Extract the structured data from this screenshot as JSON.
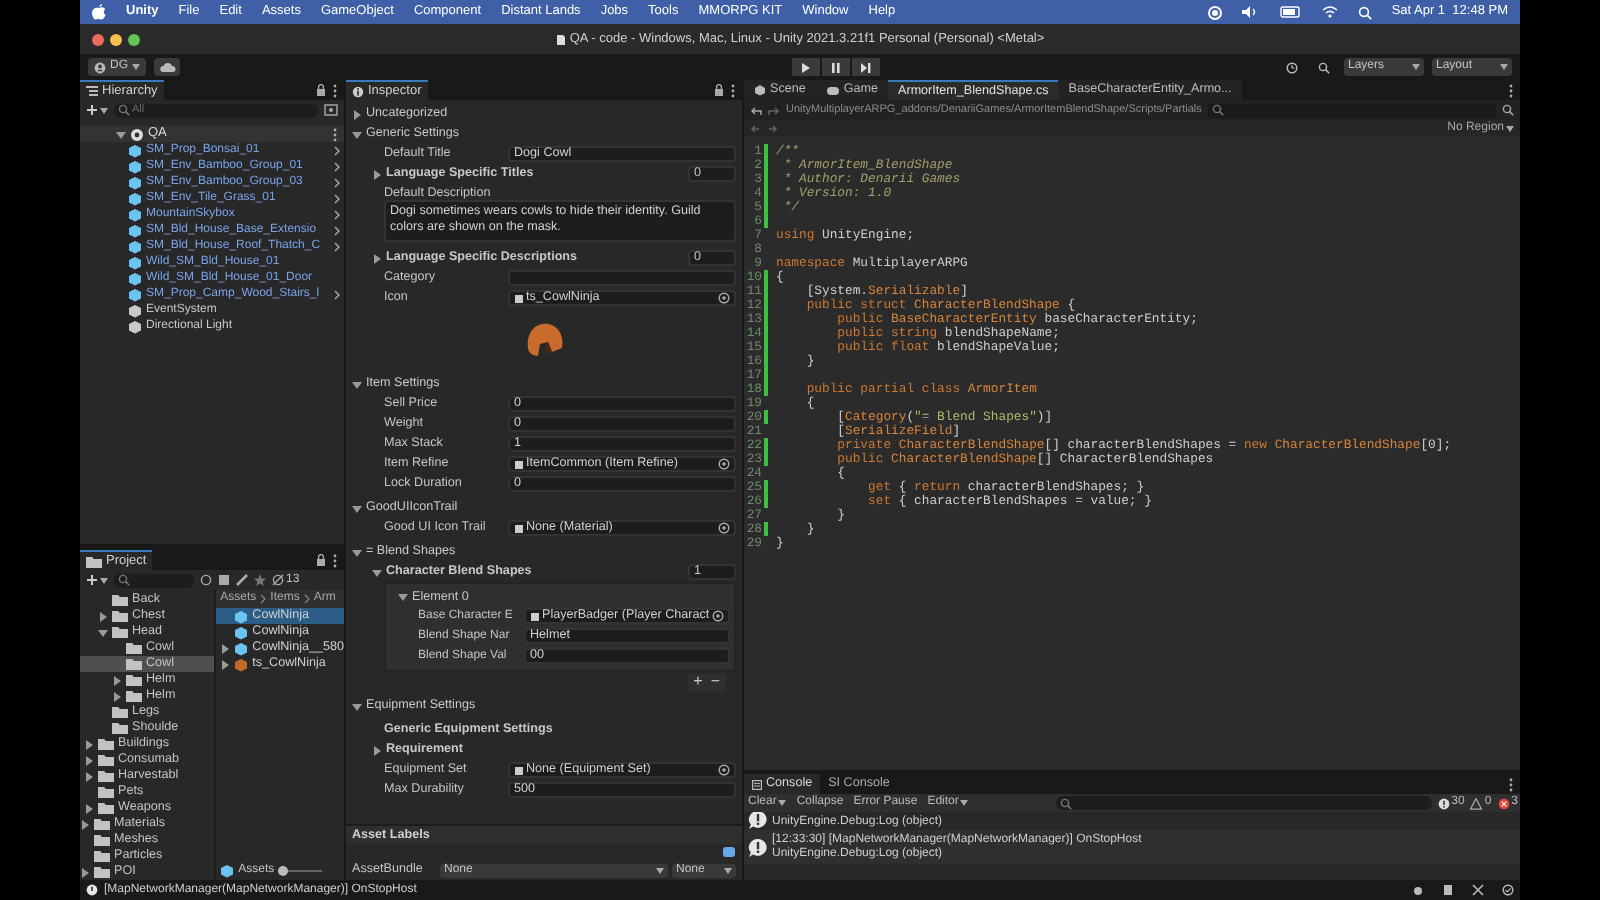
{
  "menu_bar": {
    "items": [
      {
        "label": "Unity",
        "kind": "app"
      },
      {
        "label": "File",
        "kind": "menu"
      },
      {
        "label": "Edit",
        "kind": "menu"
      },
      {
        "label": "Assets",
        "kind": "menu"
      },
      {
        "label": "GameObject",
        "kind": "menu"
      },
      {
        "label": "Component",
        "kind": "menu"
      },
      {
        "label": "Distant Lands",
        "kind": "menu"
      },
      {
        "label": "Jobs",
        "kind": "menu"
      },
      {
        "label": "Tools",
        "kind": "menu"
      },
      {
        "label": "MMORPG KIT",
        "kind": "menu"
      },
      {
        "label": "Window",
        "kind": "menu"
      },
      {
        "label": "Help",
        "kind": "menu"
      }
    ],
    "clock": "Sat Apr 1  12:48 PM"
  },
  "window": {
    "title": "QA - code - Windows, Mac, Linux - Unity 2021.3.21f1 Personal (Personal) <Metal>"
  },
  "toolbar": {
    "account": "DG",
    "layers": "Layers",
    "layout": "Layout"
  },
  "hierarchy": {
    "title": "Hierarchy",
    "search": {
      "placeholder": "All"
    },
    "scene": "QA",
    "items": [
      {
        "label": "SM_Prop_Bonsai_01",
        "kind": "prefab",
        "has_children": true
      },
      {
        "label": "SM_Env_Bamboo_Group_01",
        "kind": "prefab",
        "has_children": true
      },
      {
        "label": "SM_Env_Bamboo_Group_03",
        "kind": "prefab",
        "has_children": true
      },
      {
        "label": "SM_Env_Tile_Grass_01",
        "kind": "prefab",
        "has_children": true
      },
      {
        "label": "MountainSkybox",
        "kind": "prefab",
        "has_children": true
      },
      {
        "label": "SM_Bld_House_Base_Extensio",
        "kind": "prefab",
        "has_children": true
      },
      {
        "label": "SM_Bld_House_Roof_Thatch_C",
        "kind": "prefab",
        "has_children": true
      },
      {
        "label": "Wild_SM_Bld_House_01",
        "kind": "prefab",
        "has_children": false
      },
      {
        "label": "Wild_SM_Bld_House_01_Door",
        "kind": "prefab",
        "has_children": false
      },
      {
        "label": "SM_Prop_Camp_Wood_Stairs_l",
        "kind": "prefab",
        "has_children": true
      },
      {
        "label": "EventSystem",
        "kind": "object",
        "has_children": false
      },
      {
        "label": "Directional Light",
        "kind": "object",
        "has_children": false
      }
    ]
  },
  "project": {
    "title": "Project",
    "hidden_count": "13",
    "folders": [
      {
        "children": [
          {
            "children": [
              {
                "label": "Back",
                "selected": false
              },
              {
                "label": "Chest",
                "expanded": false,
                "selected": false
              },
              {
                "label": "Head",
                "expanded": true,
                "selected": false,
                "children": [
                  {
                    "label": "Cowl",
                    "selected": false
                  },
                  {
                    "label": "Cowl",
                    "selected": true
                  },
                  {
                    "label": "Helm",
                    "expanded": false,
                    "selected": false
                  },
                  {
                    "label": "Helm",
                    "expanded": false,
                    "selected": false
                  }
                ]
              },
              {
                "label": "Legs",
                "selected": false
              },
              {
                "label": "Shoulde",
                "selected": false
              }
            ]
          },
          {
            "label": "Buildings",
            "expanded": false,
            "selected": false
          },
          {
            "label": "Consumab",
            "expanded": false,
            "selected": false
          },
          {
            "label": "Harvestabl",
            "expanded": false,
            "selected": false
          },
          {
            "label": "Pets",
            "selected": false
          },
          {
            "label": "Weapons",
            "expanded": false,
            "selected": false
          }
        ]
      },
      {
        "label": "Materials",
        "expanded": false,
        "selected": false
      },
      {
        "label": "Meshes",
        "selected": false
      },
      {
        "label": "Particles",
        "selected": false
      },
      {
        "label": "POI",
        "expanded": false,
        "selected": false
      }
    ],
    "breadcrumb": [
      "Assets",
      "Items",
      "Arm"
    ],
    "assets": [
      {
        "label": "CowlNinja",
        "selected": true
      },
      {
        "label": "CowlNinja",
        "selected": false
      },
      {
        "label": "CowlNinja__580",
        "selected": false,
        "expanded": false
      },
      {
        "label": "ts_CowlNinja",
        "selected": false,
        "expanded": false
      }
    ],
    "footer": "Assets",
    "zoom": {
      "level": 0
    }
  },
  "inspector": {
    "title": "Inspector",
    "items": [
      {
        "kind": "foldout",
        "label": "Uncategorized",
        "expanded": false
      },
      {
        "kind": "foldout",
        "label": "Generic Settings",
        "expanded": true
      },
      {
        "kind": "field",
        "label": "Default Title",
        "value": "Dogi Cowl"
      },
      {
        "kind": "list",
        "label": "Language Specific Titles",
        "count": "0",
        "expanded": false
      },
      {
        "kind": "textarea",
        "label": "Default Description",
        "value": "Dogi sometimes wears cowls to hide their identity. Guild colors are shown on the mask."
      },
      {
        "kind": "list",
        "label": "Language Specific Descriptions",
        "count": "0",
        "expanded": false
      },
      {
        "kind": "field",
        "label": "Category"
      },
      {
        "kind": "object",
        "label": "Icon",
        "value": "ts_CowlNinja"
      },
      {
        "kind": "preview"
      },
      {
        "kind": "foldout",
        "label": "Item Settings",
        "expanded": true
      },
      {
        "kind": "field",
        "label": "Sell Price",
        "value": "0"
      },
      {
        "kind": "field",
        "label": "Weight",
        "value": "0"
      },
      {
        "kind": "field",
        "label": "Max Stack",
        "value": "1"
      },
      {
        "kind": "object",
        "label": "Item Refine",
        "value": "ItemCommon (Item Refine)"
      },
      {
        "kind": "field",
        "label": "Lock Duration",
        "value": "0"
      },
      {
        "kind": "foldout",
        "label": "GoodUIIconTrail",
        "expanded": true
      },
      {
        "kind": "object",
        "label": "Good UI Icon Trail",
        "value": "None (Material)"
      },
      {
        "kind": "foldout",
        "label": "= Blend Shapes",
        "expanded": true
      },
      {
        "kind": "list",
        "label": "Character Blend Shapes",
        "count": "1",
        "expanded": true
      },
      {
        "kind": "element",
        "label": "Element 0",
        "expanded": true,
        "fields": [
          {
            "label": "Base Character E",
            "value": "PlayerBadger (Player Charact",
            "picker": true
          },
          {
            "label": "Blend Shape Nar",
            "value": "Helmet",
            "picker": false
          },
          {
            "label": "Blend Shape Val",
            "value": "00",
            "picker": false
          }
        ]
      },
      {
        "kind": "buttons",
        "add": "+",
        "remove": "−"
      },
      {
        "kind": "foldout",
        "label": "Equipment Settings",
        "expanded": true
      },
      {
        "kind": "subheading",
        "label": "Generic Equipment Settings"
      },
      {
        "kind": "list",
        "label": "Requirement",
        "expanded": false
      },
      {
        "kind": "object",
        "label": "Equipment Set",
        "value": "None (Equipment Set)"
      },
      {
        "kind": "field",
        "label": "Max Durability",
        "value": "500"
      }
    ],
    "asset_labels": "Asset Labels",
    "asset_bundle": {
      "label": "AssetBundle",
      "bundle": "None",
      "variant": "None"
    }
  },
  "editor": {
    "tabs": [
      {
        "label": "Scene",
        "selected": false
      },
      {
        "label": "Game",
        "selected": false
      },
      {
        "label": "ArmorItem_BlendShape.cs",
        "selected": true
      },
      {
        "label": "BaseCharacterEntity_Armo...",
        "selected": false
      }
    ],
    "path": "UnityMultiplayerARPG_addons/DenariiGames/ArmorItemBlendShape/Scripts/Partials",
    "region": "No Region",
    "lines": [
      {
        "number": "1",
        "changed": true,
        "segments": [
          {
            "kind": "comment",
            "text": "/**"
          }
        ]
      },
      {
        "number": "2",
        "changed": true,
        "segments": [
          {
            "kind": "comment",
            "text": " * ArmorItem_BlendShape"
          }
        ]
      },
      {
        "number": "3",
        "changed": true,
        "segments": [
          {
            "kind": "comment",
            "text": " * Author: Denarii Games"
          }
        ]
      },
      {
        "number": "4",
        "changed": true,
        "segments": [
          {
            "kind": "comment",
            "text": " * Version: 1.0"
          }
        ]
      },
      {
        "number": "5",
        "changed": true,
        "segments": [
          {
            "kind": "comment",
            "text": " */"
          }
        ]
      },
      {
        "number": "6",
        "changed": true
      },
      {
        "number": "7",
        "changed": false,
        "segments": [
          {
            "kind": "keyword",
            "text": "using"
          },
          {
            "kind": "plain",
            "text": " UnityEngine;"
          }
        ]
      },
      {
        "number": "8",
        "changed": false
      },
      {
        "number": "9",
        "changed": false,
        "segments": [
          {
            "kind": "keyword",
            "text": "namespace"
          },
          {
            "kind": "plain",
            "text": " MultiplayerARPG"
          }
        ]
      },
      {
        "number": "10",
        "changed": true,
        "segments": [
          {
            "kind": "plain",
            "text": "{"
          }
        ]
      },
      {
        "number": "11",
        "changed": true,
        "segments": [
          {
            "kind": "plain",
            "text": "    [System."
          },
          {
            "kind": "type",
            "text": "Serializable"
          },
          {
            "kind": "plain",
            "text": "]"
          }
        ]
      },
      {
        "number": "12",
        "changed": true,
        "segments": [
          {
            "kind": "keyword",
            "text": "    public struct "
          },
          {
            "kind": "type",
            "text": "CharacterBlendShape"
          },
          {
            "kind": "plain",
            "text": " {"
          }
        ]
      },
      {
        "number": "13",
        "changed": true,
        "segments": [
          {
            "kind": "keyword",
            "text": "        public "
          },
          {
            "kind": "type",
            "text": "BaseCharacterEntity"
          },
          {
            "kind": "plain",
            "text": " baseCharacterEntity;"
          }
        ]
      },
      {
        "number": "14",
        "changed": true,
        "segments": [
          {
            "kind": "keyword",
            "text": "        public string"
          },
          {
            "kind": "plain",
            "text": " blendShapeName;"
          }
        ]
      },
      {
        "number": "15",
        "changed": true,
        "segments": [
          {
            "kind": "keyword",
            "text": "        public float"
          },
          {
            "kind": "plain",
            "text": " blendShapeValue;"
          }
        ]
      },
      {
        "number": "16",
        "changed": true,
        "segments": [
          {
            "kind": "plain",
            "text": "    }"
          }
        ]
      },
      {
        "number": "17",
        "changed": true
      },
      {
        "number": "18",
        "changed": true,
        "segments": [
          {
            "kind": "keyword",
            "text": "    public partial class "
          },
          {
            "kind": "type",
            "text": "ArmorItem"
          }
        ]
      },
      {
        "number": "19",
        "changed": false,
        "segments": [
          {
            "kind": "plain",
            "text": "    {"
          }
        ]
      },
      {
        "number": "20",
        "changed": true,
        "segments": [
          {
            "kind": "plain",
            "text": "        ["
          },
          {
            "kind": "type",
            "text": "Category"
          },
          {
            "kind": "plain",
            "text": "("
          },
          {
            "kind": "string",
            "text": "\"= Blend Shapes\""
          },
          {
            "kind": "plain",
            "text": ")]"
          }
        ]
      },
      {
        "number": "21",
        "changed": false,
        "segments": [
          {
            "kind": "plain",
            "text": "        ["
          },
          {
            "kind": "type",
            "text": "SerializeField"
          },
          {
            "kind": "plain",
            "text": "]"
          }
        ]
      },
      {
        "number": "22",
        "changed": true,
        "segments": [
          {
            "kind": "keyword",
            "text": "        private "
          },
          {
            "kind": "type",
            "text": "CharacterBlendShape"
          },
          {
            "kind": "plain",
            "text": "[] characterBlendShapes = "
          },
          {
            "kind": "keyword",
            "text": "new "
          },
          {
            "kind": "type",
            "text": "CharacterBlendShape"
          },
          {
            "kind": "plain",
            "text": "[0];"
          }
        ]
      },
      {
        "number": "23",
        "changed": true,
        "segments": [
          {
            "kind": "keyword",
            "text": "        public "
          },
          {
            "kind": "type",
            "text": "CharacterBlendShape"
          },
          {
            "kind": "plain",
            "text": "[] CharacterBlendShapes"
          }
        ]
      },
      {
        "number": "24",
        "changed": false,
        "segments": [
          {
            "kind": "plain",
            "text": "        {"
          }
        ]
      },
      {
        "number": "25",
        "changed": true,
        "segments": [
          {
            "kind": "keyword",
            "text": "            get"
          },
          {
            "kind": "plain",
            "text": " { "
          },
          {
            "kind": "keyword",
            "text": "return"
          },
          {
            "kind": "plain",
            "text": " characterBlendShapes; }"
          }
        ]
      },
      {
        "number": "26",
        "changed": true,
        "segments": [
          {
            "kind": "keyword",
            "text": "            set"
          },
          {
            "kind": "plain",
            "text": " { characterBlendShapes = value; }"
          }
        ]
      },
      {
        "number": "27",
        "changed": false,
        "segments": [
          {
            "kind": "plain",
            "text": "        }"
          }
        ]
      },
      {
        "number": "28",
        "changed": true,
        "segments": [
          {
            "kind": "plain",
            "text": "    }"
          }
        ]
      },
      {
        "number": "29",
        "changed": false,
        "segments": [
          {
            "kind": "plain",
            "text": "}"
          }
        ]
      }
    ]
  },
  "console": {
    "tabs": [
      {
        "label": "Console",
        "selected": true
      },
      {
        "label": "SI Console",
        "selected": false
      }
    ],
    "buttons": [
      "Clear",
      "Collapse",
      "Error Pause",
      "Editor"
    ],
    "counts": {
      "info": "30",
      "warnings": "0",
      "errors": "3"
    },
    "entries": [
      {
        "lines": [
          "UnityEngine.Debug:Log (object)"
        ]
      },
      {
        "lines": [
          "[12:33:30] [MapNetworkManager(MapNetworkManager)] OnStopHost",
          "UnityEngine.Debug:Log (object)"
        ]
      }
    ]
  },
  "status_bar": {
    "message": "[MapNetworkManager(MapNetworkManager)] OnStopHost"
  }
}
